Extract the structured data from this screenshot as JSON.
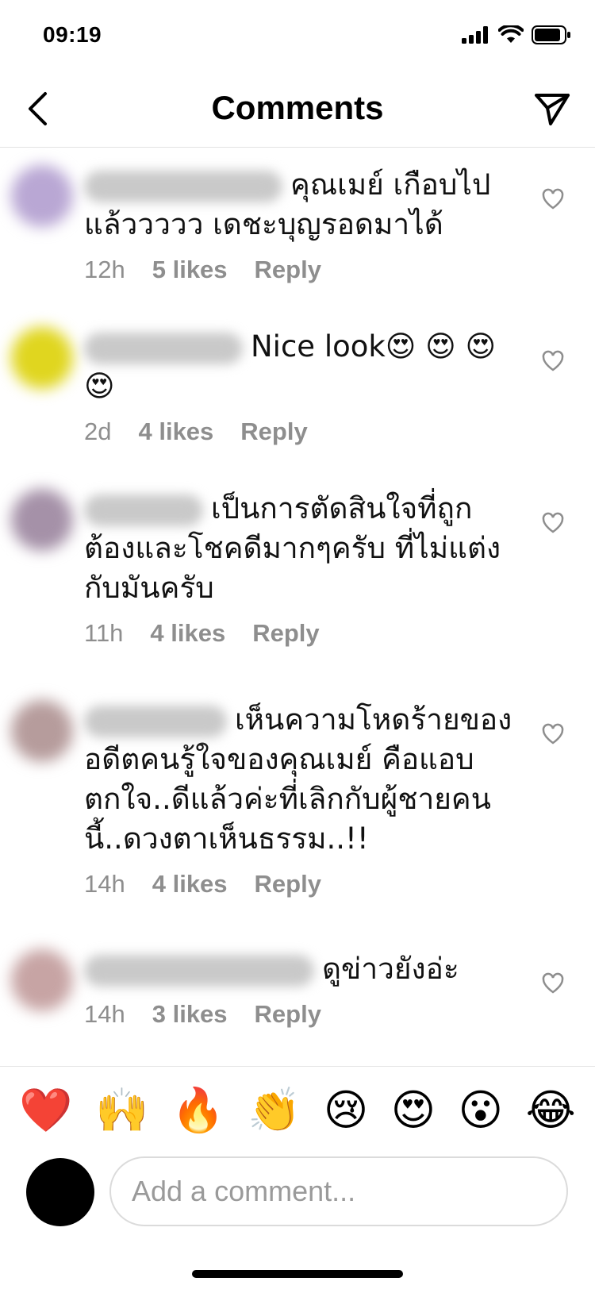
{
  "status": {
    "time": "09:19"
  },
  "nav": {
    "title": "Comments",
    "back_icon": "chevron-left-icon",
    "send_icon": "paper-plane-icon"
  },
  "comments": [
    {
      "text": "คุณเมย์ เกือบไป แล้ววววว เดชะบุญรอดมาได้",
      "time": "12h",
      "likes": "5 likes",
      "reply": "Reply"
    },
    {
      "text": "Nice look😍 😍 😍 😍",
      "time": "2d",
      "likes": "4 likes",
      "reply": "Reply"
    },
    {
      "text": "เป็นการตัดสินใจที่ถูกต้องและโชคดีมากๆครับ ที่ไม่แต่งกับมันครับ",
      "time": "11h",
      "likes": "4 likes",
      "reply": "Reply"
    },
    {
      "text": "เห็นความโหดร้ายของอดีตคนรู้ใจของคุณเมย์ คือแอบตกใจ..ดีแล้วค่ะที่เลิกกับผู้ชายคนนี้..ดวงตาเห็นธรรม..!!",
      "time": "14h",
      "likes": "4 likes",
      "reply": "Reply"
    },
    {
      "text": "ดูข่าวยังอ่ะ",
      "time": "14h",
      "likes": "3 likes",
      "reply": "Reply"
    }
  ],
  "emoji_bar": [
    "❤️",
    "🙌",
    "🔥",
    "👏",
    "😢",
    "😍",
    "😮",
    "😂"
  ],
  "composer": {
    "placeholder": "Add a comment..."
  },
  "colors": {
    "meta_gray": "#8e8e8e",
    "divider": "#e2e2e2"
  }
}
